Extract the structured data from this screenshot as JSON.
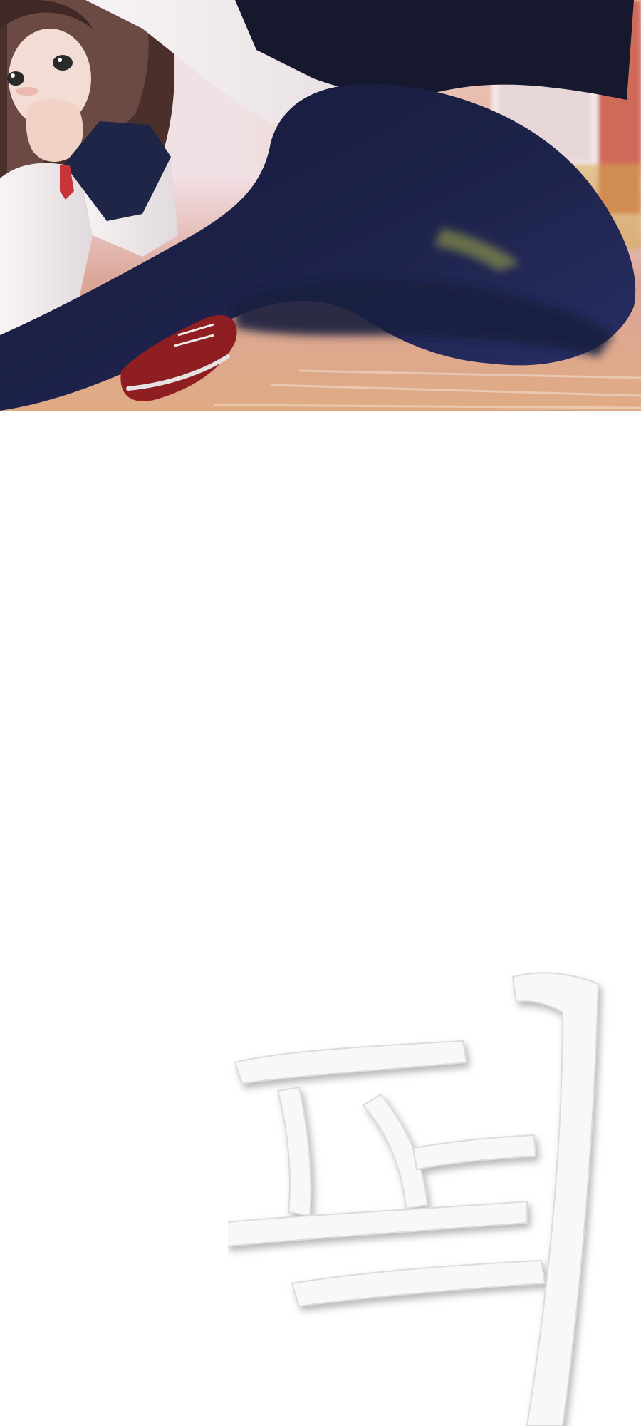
{
  "page": {
    "background": "#ffffff"
  },
  "panel": {
    "kind": "manga-panel",
    "palette": {
      "background": "#e7d1d5",
      "warm_floor": "#d6926f",
      "dark_pants": "#1a1d3f",
      "white_shirt": "#f3efef",
      "hair": "#5a3a34",
      "red_tie": "#c7353a"
    }
  },
  "sfx": {
    "text": "퍽",
    "color": "#f7f7f7",
    "shadow": "#bdbdbd"
  }
}
